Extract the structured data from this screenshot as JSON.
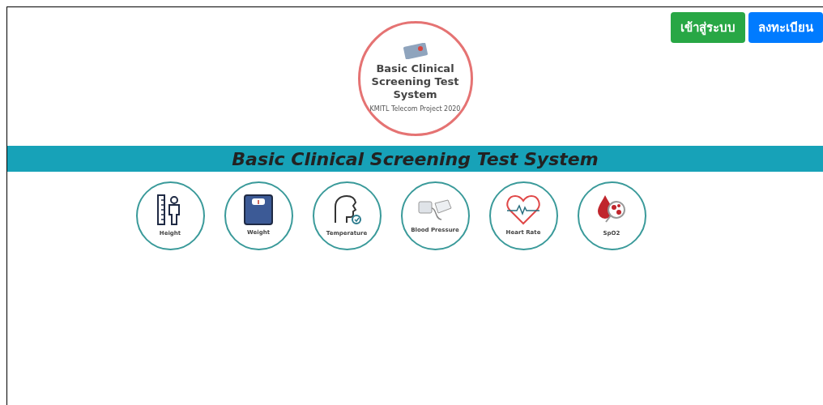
{
  "buttons": [
    {
      "label": "เข้าสู่ระบบ",
      "kind": "login"
    },
    {
      "label": "ลงทะเบียน",
      "kind": "register"
    }
  ],
  "logo": {
    "title": "Basic Clinical Screening Test System",
    "subtitle": "KMITL Telecom Project 2020"
  },
  "banner": {
    "title": "Basic Clinical Screening Test System"
  },
  "measurements": [
    {
      "label": "Height",
      "kind": "height"
    },
    {
      "label": "Weight",
      "kind": "weight"
    },
    {
      "label": "Temperature",
      "kind": "temperature"
    },
    {
      "label": "Blood Pressure",
      "kind": "pressure"
    },
    {
      "label": "Heart Rate",
      "kind": "heart"
    },
    {
      "label": "SpO2",
      "kind": "spo2"
    }
  ]
}
